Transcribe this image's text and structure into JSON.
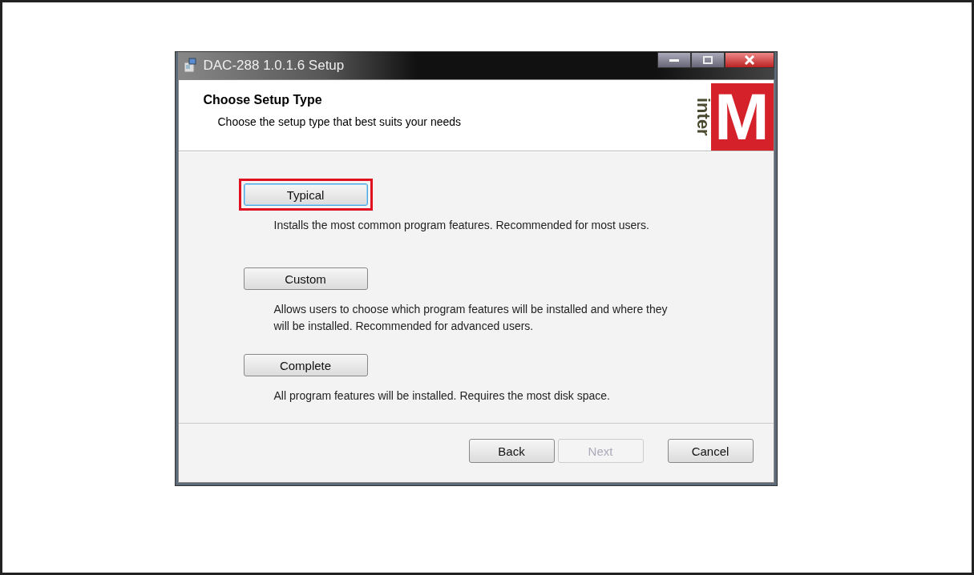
{
  "window": {
    "title": "DAC-288 1.0.1.6 Setup"
  },
  "header": {
    "title": "Choose Setup Type",
    "subtitle": "Choose the setup type that best suits your needs"
  },
  "logo": {
    "word": "inter",
    "letter": "M"
  },
  "options": [
    {
      "label": "Typical",
      "description": "Installs the most common program features. Recommended for most users.",
      "selected": true
    },
    {
      "label": "Custom",
      "description": "Allows users to choose which program features will be installed and where they will be installed. Recommended for advanced users.",
      "selected": false
    },
    {
      "label": "Complete",
      "description": "All program features will be installed. Requires the most disk space.",
      "selected": false
    }
  ],
  "buttons": [
    {
      "label": "Back",
      "disabled": false
    },
    {
      "label": "Next",
      "disabled": true
    },
    {
      "label": "Cancel",
      "disabled": false
    }
  ]
}
